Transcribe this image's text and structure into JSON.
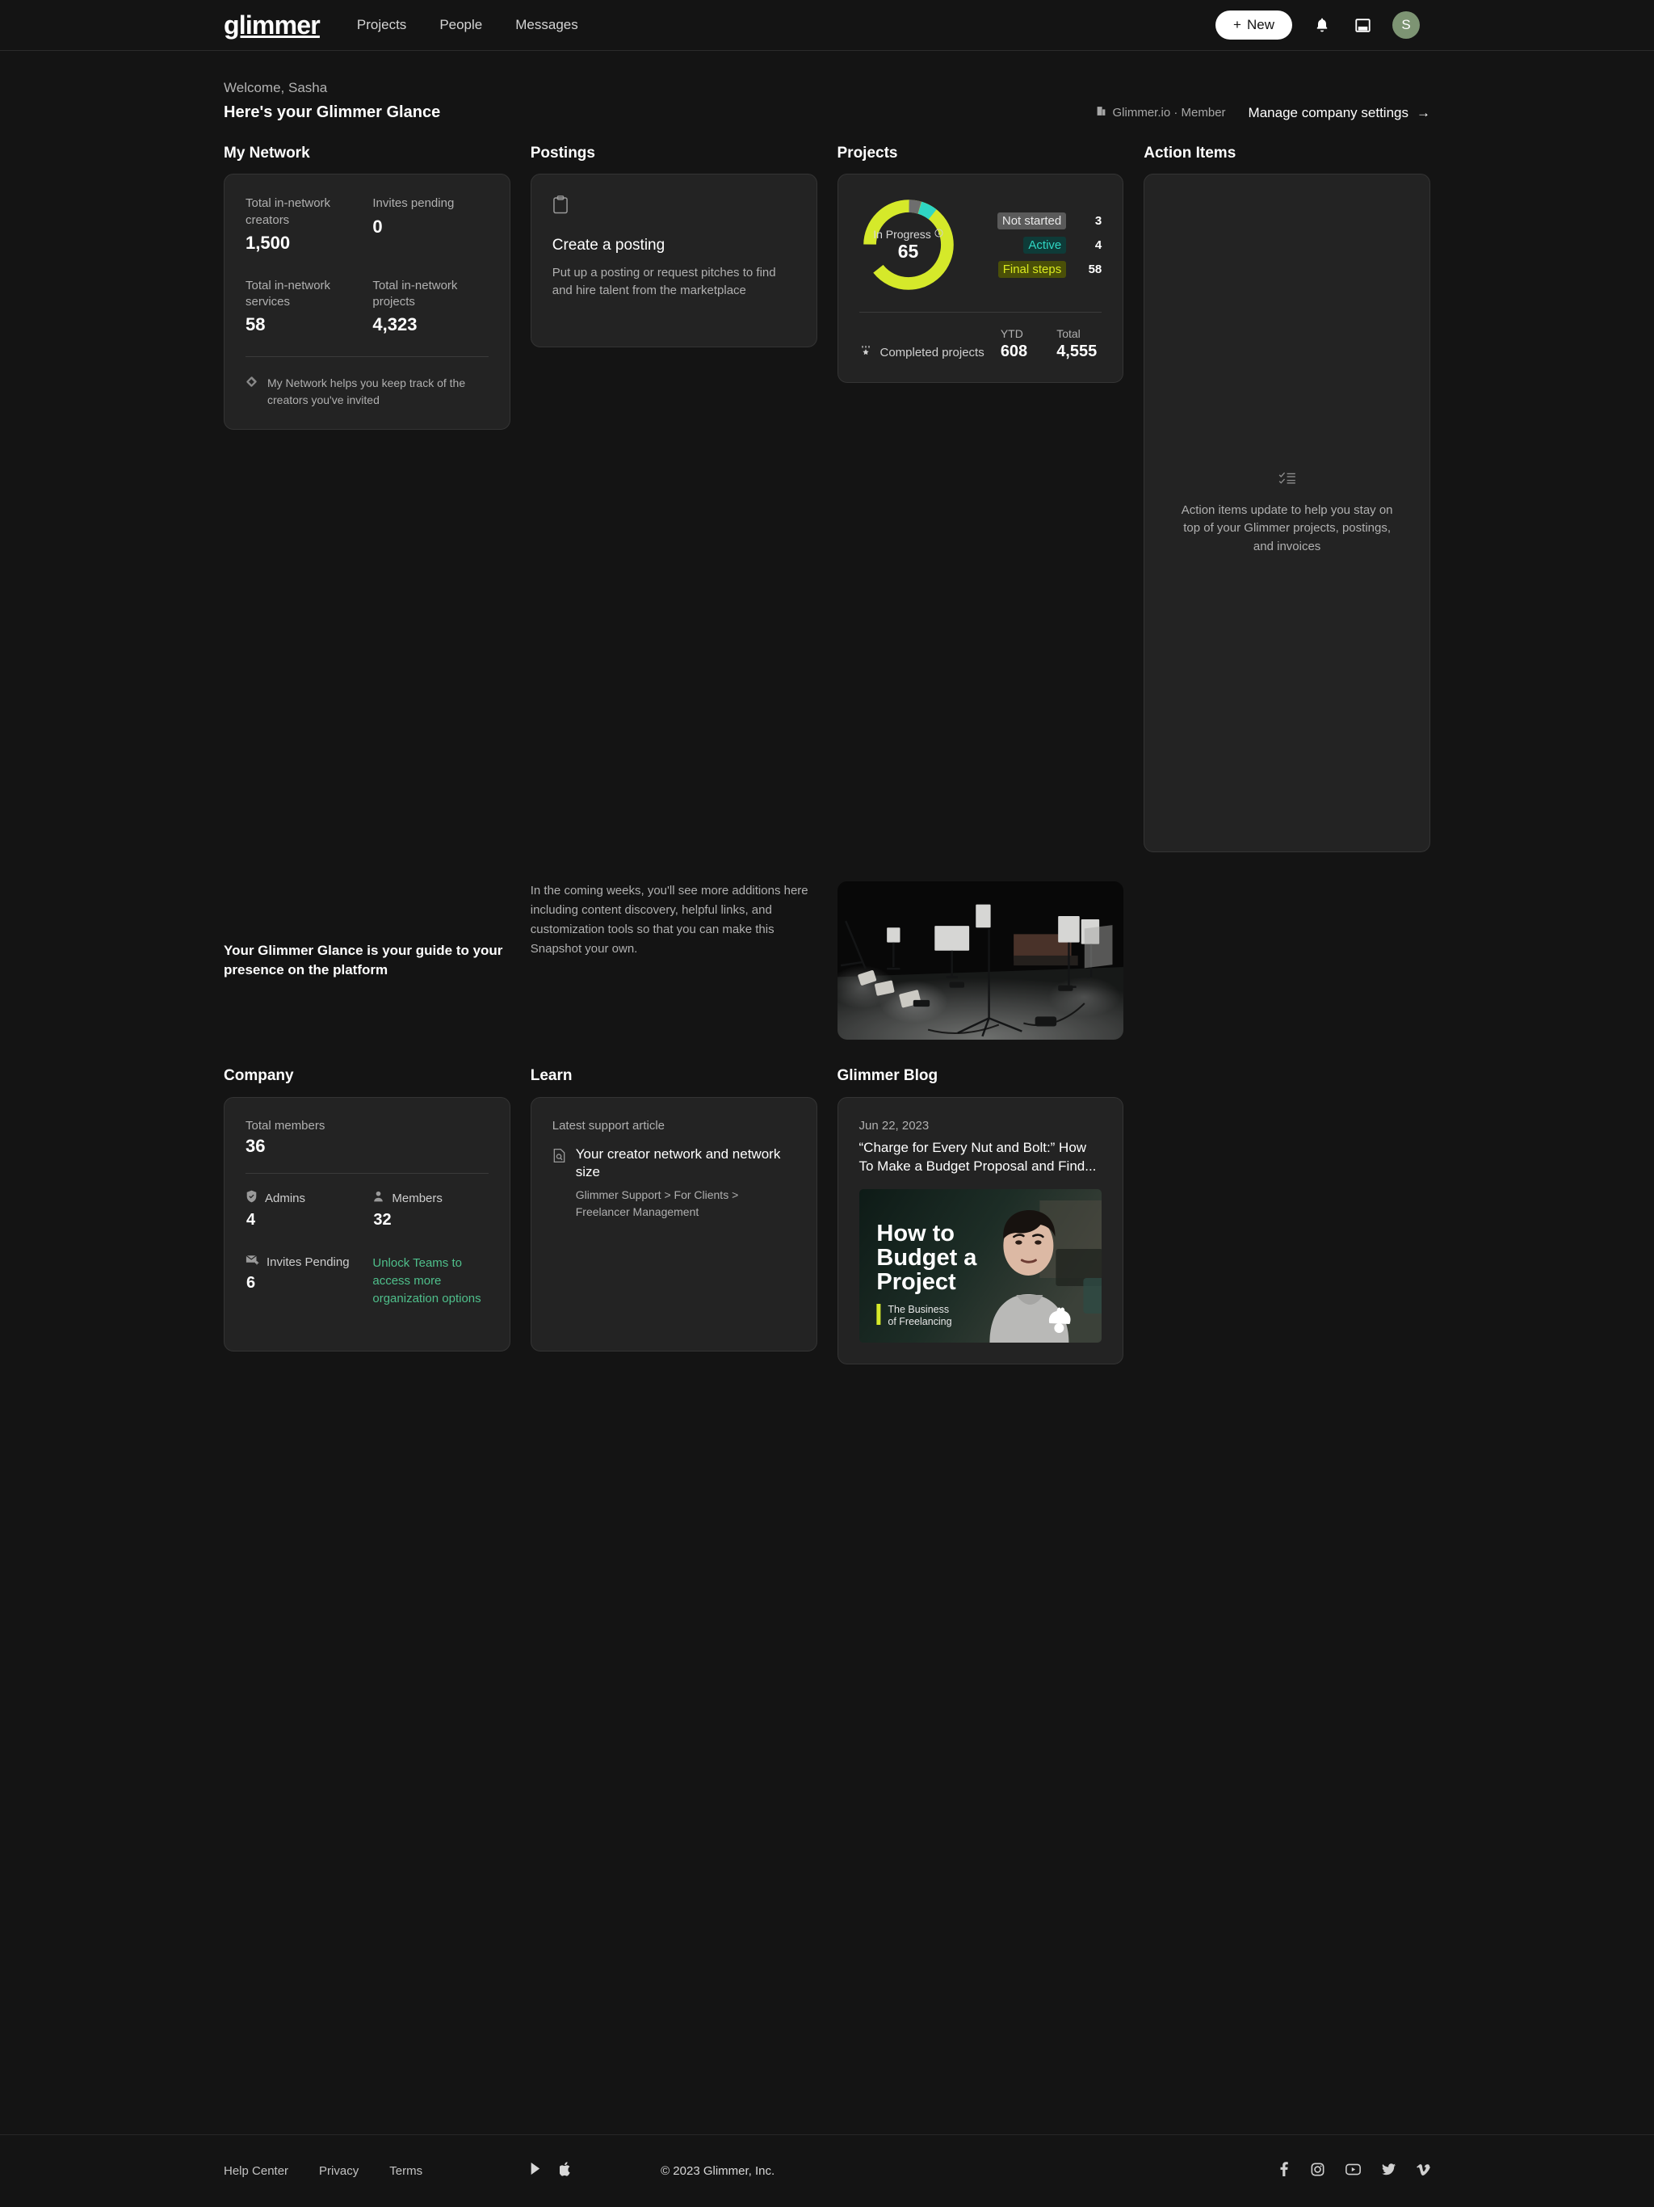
{
  "nav": {
    "logo": "glimmer",
    "links": [
      {
        "label": "Projects"
      },
      {
        "label": "People"
      },
      {
        "label": "Messages"
      }
    ],
    "new_button": "New",
    "plus_glyph": "+",
    "icons": {
      "bell": "bell-icon",
      "inbox": "inbox-icon"
    },
    "avatar_initial": "S"
  },
  "header": {
    "welcome": "Welcome, Sasha",
    "title": "Here's your Glimmer Glance",
    "org": "Glimmer.io · Member",
    "manage": "Manage company settings",
    "arrow": "→"
  },
  "my_network": {
    "heading": "My Network",
    "stats": [
      {
        "label": "Total in-network creators",
        "value": "1,500"
      },
      {
        "label": "Invites pending",
        "value": "0"
      },
      {
        "label": "Total in-network services",
        "value": "58"
      },
      {
        "label": "Total in-network projects",
        "value": "4,323"
      }
    ],
    "hint": "My Network helps you keep track of the creators you've invited"
  },
  "postings": {
    "heading": "Postings",
    "title": "Create a posting",
    "description": "Put up a posting or request pitches to find and hire talent from the marketplace"
  },
  "projects": {
    "heading": "Projects",
    "donut_label": "In Progress",
    "donut_value": "65",
    "info_glyph": "ⓘ",
    "legend": [
      {
        "label": "Not started",
        "value": "3",
        "bg": "#5a5a5a",
        "fg": "#e8e8e8"
      },
      {
        "label": "Active",
        "value": "4",
        "bg": "#0e3b38",
        "fg": "#2fd6c3"
      },
      {
        "label": "Final steps",
        "value": "58",
        "bg": "#4a4f08",
        "fg": "#d9ea1f"
      }
    ],
    "completed_label": "Completed projects",
    "ytd_label": "YTD",
    "ytd_value": "608",
    "total_label": "Total",
    "total_value": "4,555",
    "colors": {
      "final_steps": "#d5e92a",
      "not_started": "#6e6e6e",
      "active": "#2fd6c3"
    }
  },
  "action_items": {
    "heading": "Action Items",
    "empty_text": "Action items update to help you stay on top of your Glimmer projects, postings, and invoices"
  },
  "mid": {
    "headline": "Your Glimmer Glance is your guide to your presence on the platform",
    "body": "In the coming weeks, you'll see more additions here including content discovery, helpful links, and customization tools so that you can make this Snapshot your own."
  },
  "company": {
    "heading": "Company",
    "total_label": "Total members",
    "total_value": "36",
    "items": [
      {
        "icon": "shield-check-icon",
        "label": "Admins",
        "value": "4"
      },
      {
        "icon": "person-icon",
        "label": "Members",
        "value": "32"
      },
      {
        "icon": "mail-plus-icon",
        "label": "Invites Pending",
        "value": "6"
      }
    ],
    "unlock_link": "Unlock Teams to access more organization options"
  },
  "learn": {
    "heading": "Learn",
    "kicker": "Latest support article",
    "article_title": "Your creator network and network size",
    "breadcrumbs": "Glimmer Support > For Clients > Freelancer Management"
  },
  "blog": {
    "heading": "Glimmer Blog",
    "date": "Jun 22, 2023",
    "title": "“Charge for Every Nut and Bolt:” How To Make a Budget Proposal and Find...",
    "thumb_title_1": "How to",
    "thumb_title_2": "Budget a",
    "thumb_title_3": "Project",
    "thumb_series_1": "The Business",
    "thumb_series_2": "of Freelancing"
  },
  "footer": {
    "links": [
      {
        "label": "Help Center"
      },
      {
        "label": "Privacy"
      },
      {
        "label": "Terms"
      }
    ],
    "copyright": "© 2023 Glimmer, Inc.",
    "store_icons": [
      "google-play-icon",
      "apple-icon"
    ],
    "social_icons": [
      "facebook-icon",
      "instagram-icon",
      "youtube-icon",
      "twitter-icon",
      "vimeo-icon"
    ]
  },
  "chart_data": {
    "type": "pie",
    "title": "In Progress",
    "center_value": 65,
    "categories": [
      "Final steps",
      "Not started",
      "Active"
    ],
    "values": [
      58,
      3,
      4
    ],
    "colors": [
      "#d5e92a",
      "#6e6e6e",
      "#2fd6c3"
    ],
    "legend_position": "right",
    "donut": true
  }
}
